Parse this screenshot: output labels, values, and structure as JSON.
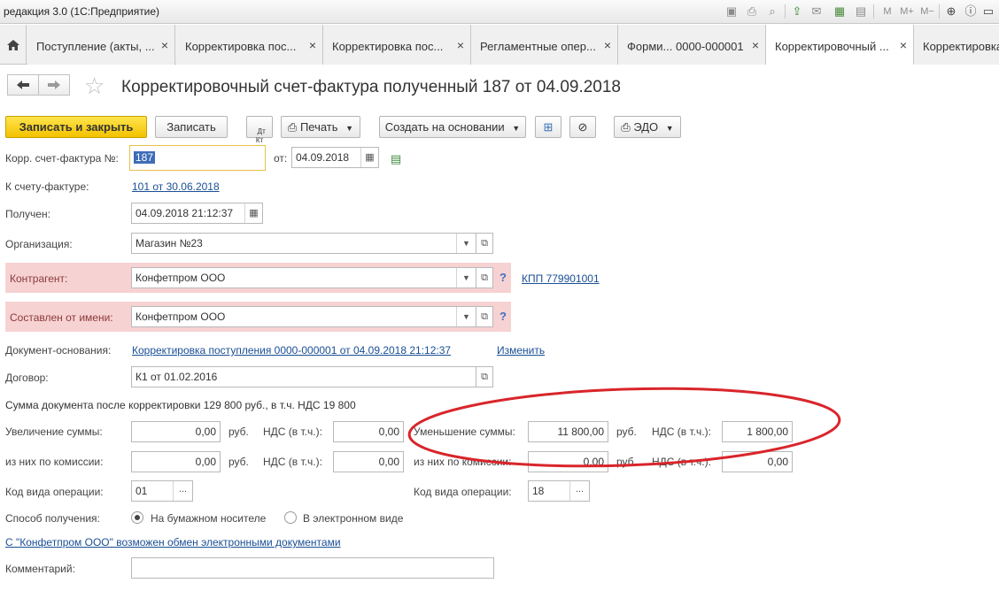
{
  "window": {
    "title": "редакция 3.0  (1С:Предприятие)"
  },
  "tabs": [
    {
      "label": "Поступление (акты, ..."
    },
    {
      "label": "Корректировка пос..."
    },
    {
      "label": "Корректировка пос..."
    },
    {
      "label": "Регламентные опер..."
    },
    {
      "label": "Форми... 0000-000001"
    },
    {
      "label": "Корректировочный ..."
    },
    {
      "label": "Корректировка"
    }
  ],
  "document": {
    "title": "Корректировочный счет-фактура полученный 187 от 04.09.2018"
  },
  "toolbar": {
    "save_close": "Записать и закрыть",
    "save": "Записать",
    "dtkt": "Дт\nКт",
    "print": "Печать",
    "create_based": "Создать на основании",
    "edo": "ЭДО"
  },
  "form": {
    "corr_invoice_label": "Корр. счет-фактура №:",
    "corr_invoice_number": "187",
    "from_label": "от:",
    "from_date": "04.09.2018",
    "to_invoice_label": "К счету-фактуре:",
    "to_invoice_link": "101 от 30.06.2018",
    "received_label": "Получен:",
    "received_value": "04.09.2018 21:12:37",
    "org_label": "Организация:",
    "org_value": "Магазин №23",
    "contractor_label": "Контрагент:",
    "contractor_value": "Конфетпром ООО",
    "kpp_link": "КПП 779901001",
    "compiled_label": "Составлен от имени:",
    "compiled_value": "Конфетпром ООО",
    "base_doc_label": "Документ-основания:",
    "base_doc_link": "Корректировка поступления 0000-000001 от 04.09.2018 21:12:37",
    "change_link": "Изменить",
    "contract_label": "Договор:",
    "contract_value": "К1 от 01.02.2016",
    "sum_summary": "Сумма документа после корректировки 129 800 руб., в т.ч. НДС 19 800",
    "increase_label": "Увеличение суммы:",
    "increase_value": "0,00",
    "rub1": "руб.",
    "vat_label_1": "НДС (в т.ч.):",
    "increase_vat": "0,00",
    "decrease_label": "Уменьшение суммы:",
    "decrease_value": "11 800,00",
    "rub2": "руб.",
    "vat_label_2": "НДС (в т.ч.):",
    "decrease_vat": "1 800,00",
    "commission_label_1": "из них по комиссии:",
    "commission_value_1": "0,00",
    "rub3": "руб.",
    "vat_label_3": "НДС (в т.ч.):",
    "commission_vat_1": "0,00",
    "commission_label_2": "из них по комиссии:",
    "commission_value_2": "0,00",
    "rub4": "руб.",
    "vat_label_4": "НДС (в т.ч.):",
    "commission_vat_2": "0,00",
    "op_code_label_1": "Код вида операции:",
    "op_code_value_1": "01",
    "op_code_label_2": "Код вида операции:",
    "op_code_value_2": "18",
    "receive_method_label": "Способ получения:",
    "paper_option": "На бумажном носителе",
    "electronic_option": "В электронном виде",
    "exchange_link": "С \"Конфетпром ООО\" возможен обмен электронными документами",
    "comment_label": "Комментарий:",
    "comment_value": ""
  },
  "colors": {
    "primary_button": "#f5cc14",
    "required_highlight": "#f7d2d2",
    "annotation_ellipse": "#d9252b",
    "link": "#1a4f95"
  }
}
